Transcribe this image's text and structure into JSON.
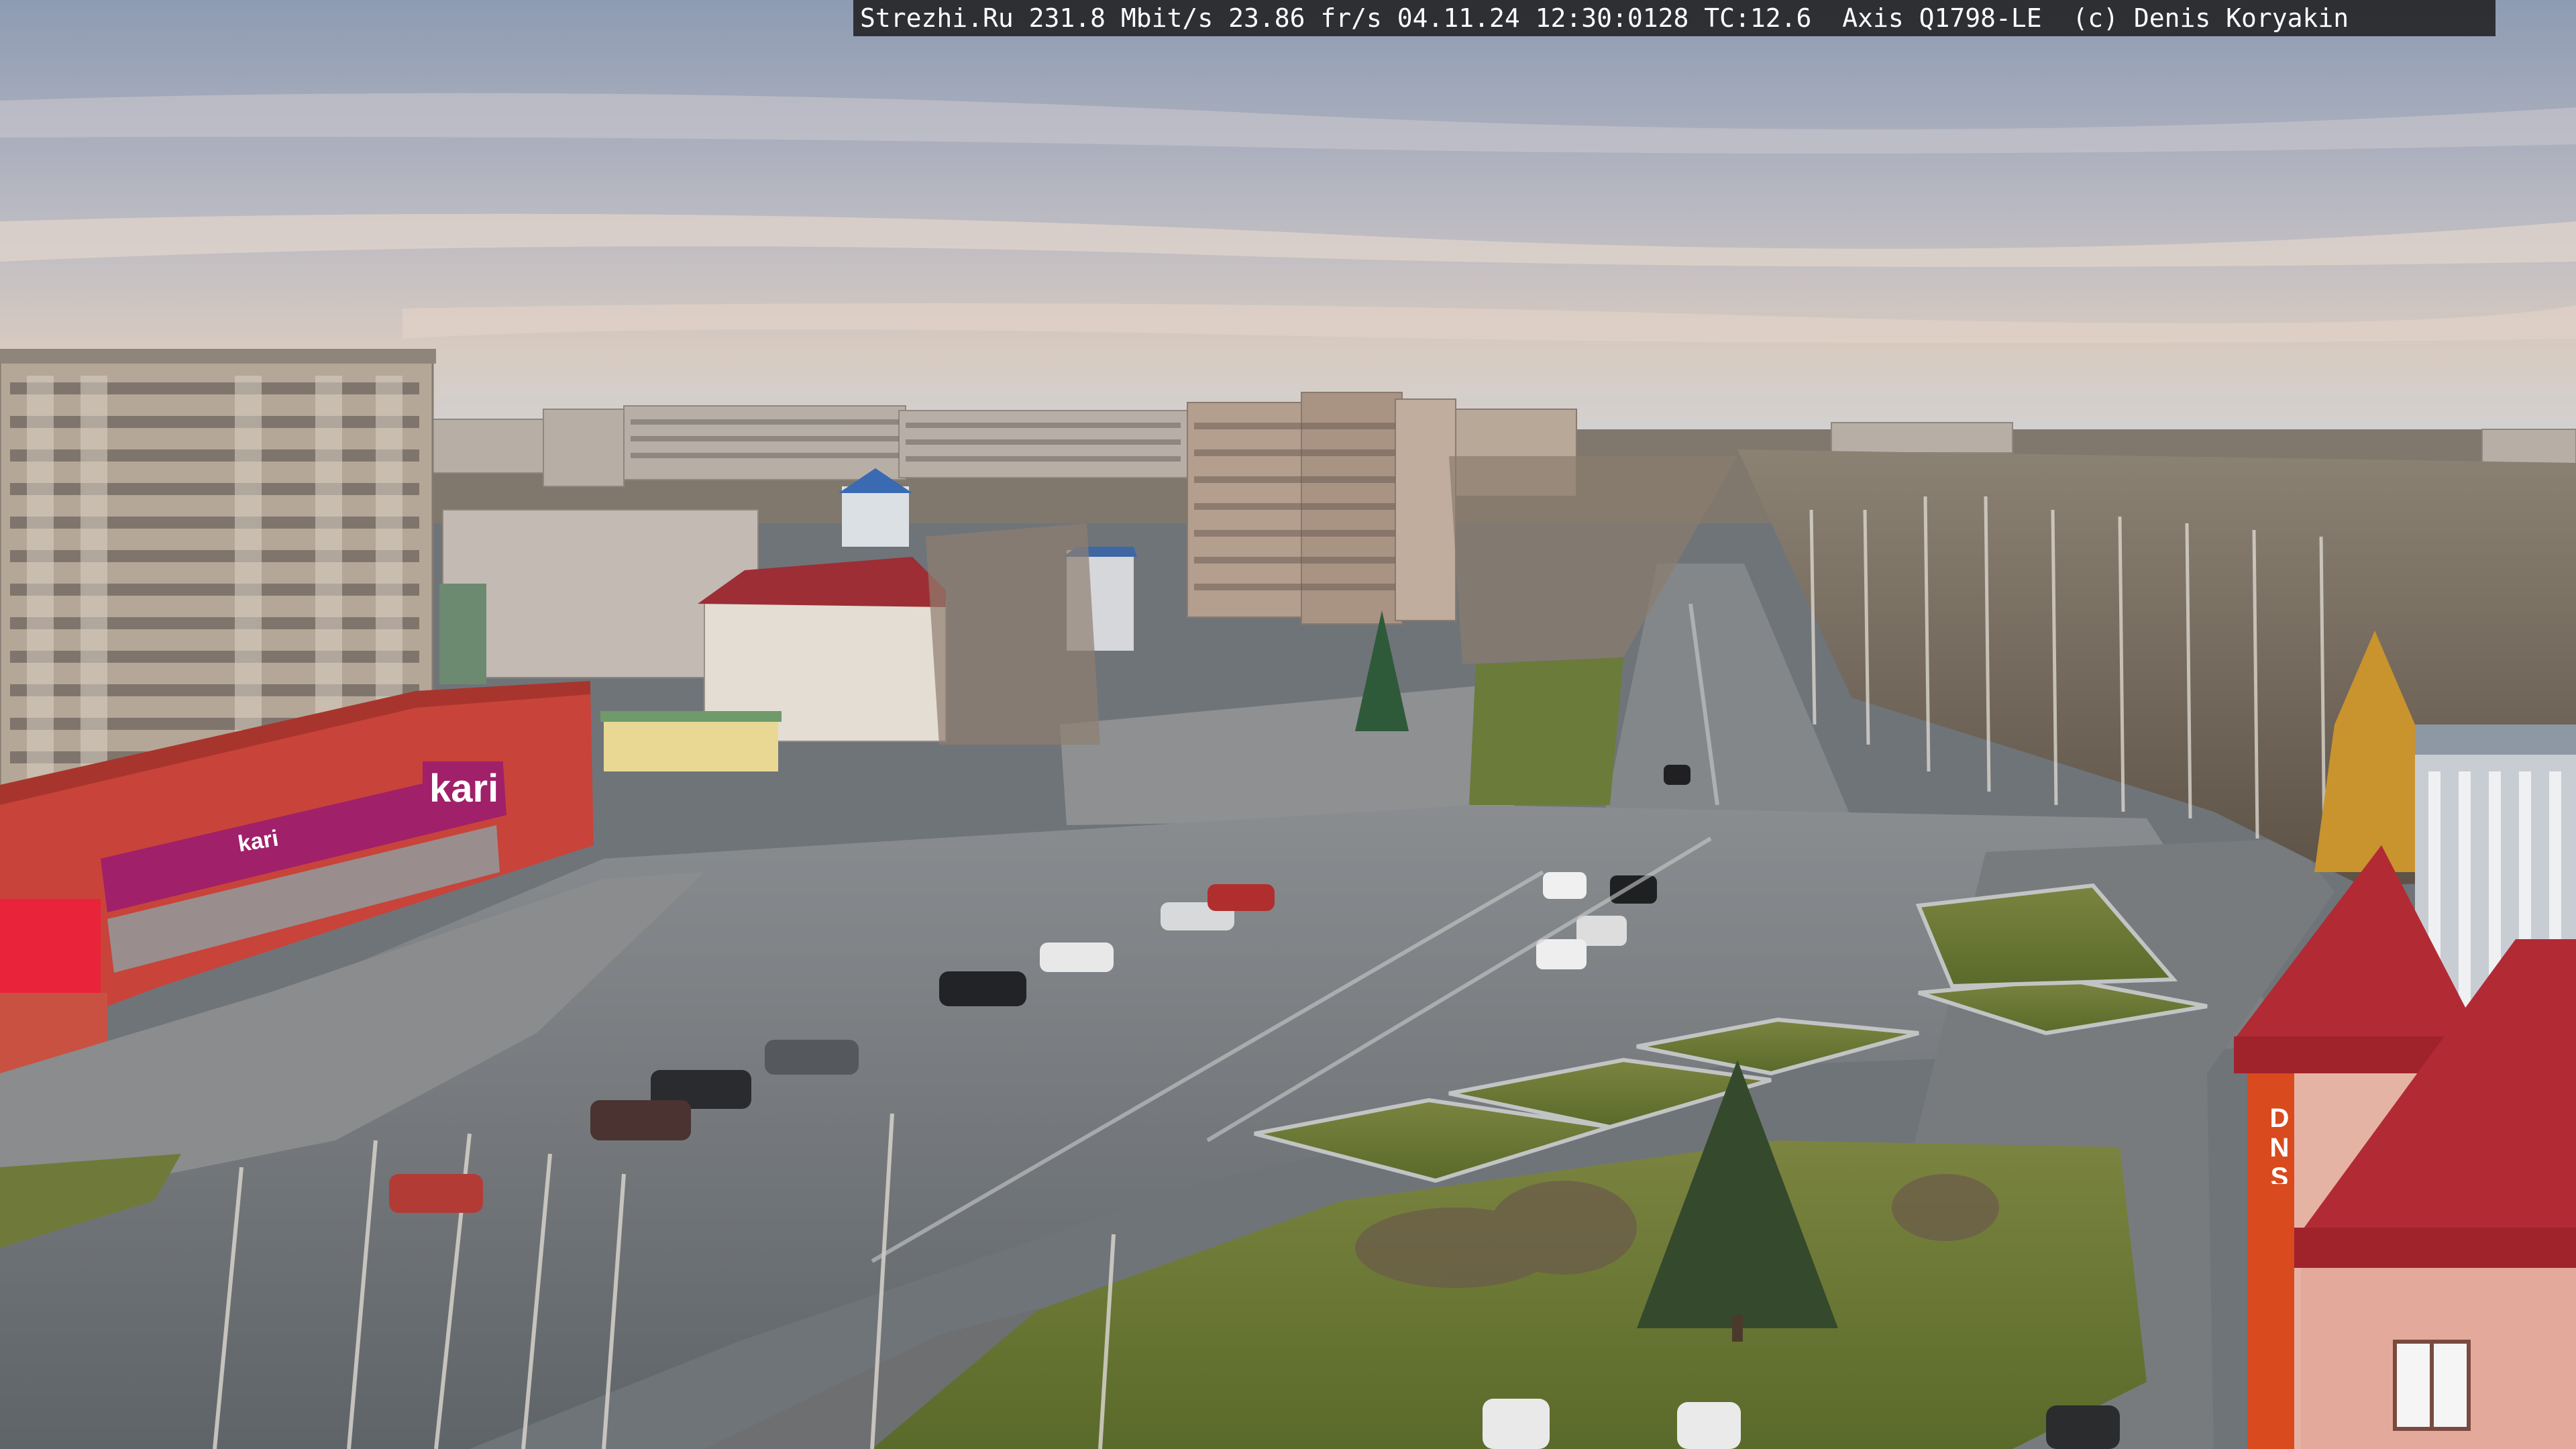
{
  "overlay": {
    "caption": "Strezhi.Ru 231.8 Mbit/s 23.86 fr/s 04.11.24 12:30:0128 TC:12.6  Axis Q1798-LE  (c) Denis Koryakin"
  },
  "signs": {
    "store_big": "kari",
    "store_strip": "kari",
    "electronics": "DNS"
  },
  "colors": {
    "sky_top": "#8f9fb8",
    "sky_bottom": "#d9cdc4",
    "road": "#6e7377",
    "grass": "#6f7a3a",
    "brick_red": "#c8433a",
    "magenta_sign": "#a0206a",
    "roof_red": "#b22a34"
  }
}
